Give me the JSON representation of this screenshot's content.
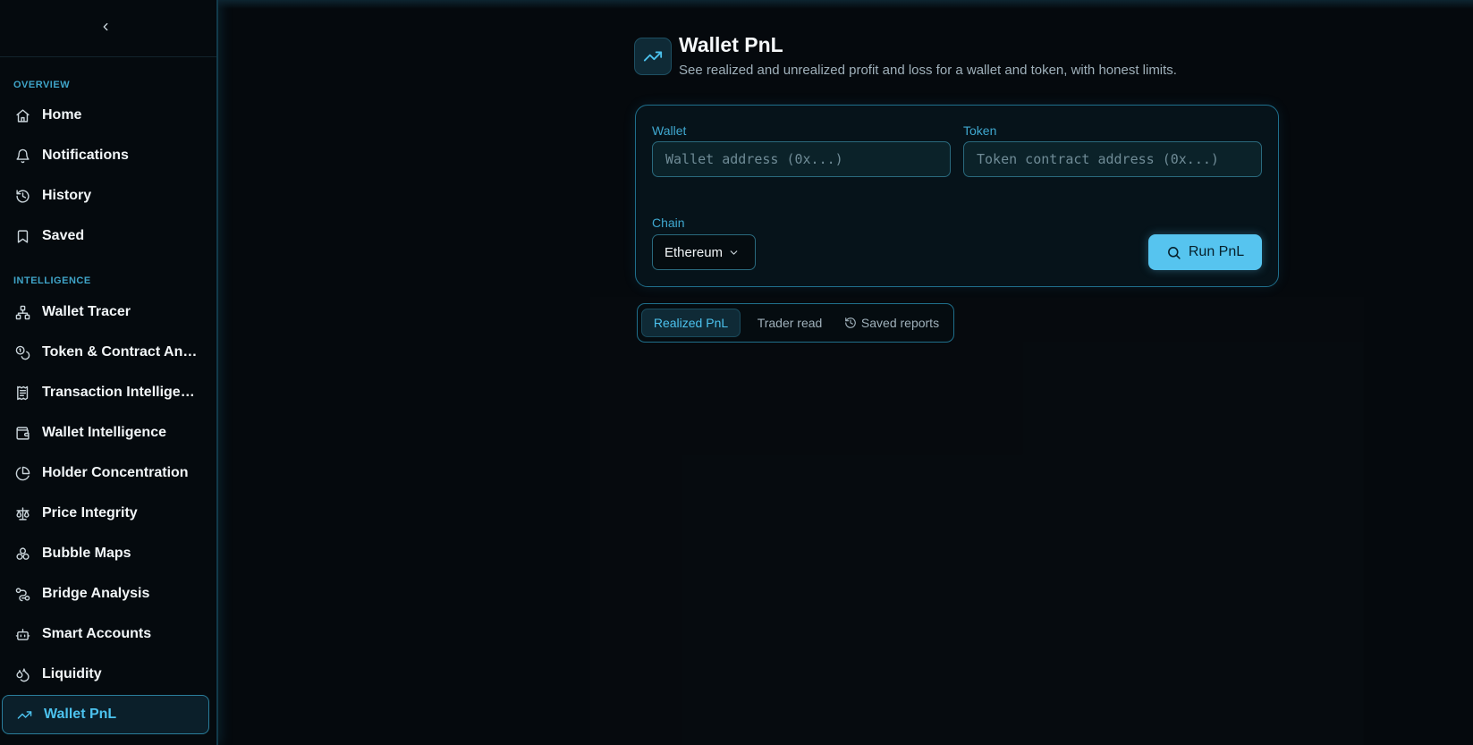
{
  "sidebar": {
    "collapse_icon": "chevron-left-icon",
    "sections": [
      {
        "label": "OVERVIEW"
      },
      {
        "label": "INTELLIGENCE"
      }
    ],
    "items": [
      {
        "label": "Home",
        "icon": "home-icon"
      },
      {
        "label": "Notifications",
        "icon": "bell-icon"
      },
      {
        "label": "History",
        "icon": "history-icon"
      },
      {
        "label": "Saved",
        "icon": "bookmark-icon"
      },
      {
        "label": "Wallet Tracer",
        "icon": "network-icon"
      },
      {
        "label": "Token & Contract Anal…",
        "icon": "coins-icon"
      },
      {
        "label": "Transaction Intelligen…",
        "icon": "receipt-icon"
      },
      {
        "label": "Wallet Intelligence",
        "icon": "wallet-icon"
      },
      {
        "label": "Holder Concentration",
        "icon": "pie-chart-icon"
      },
      {
        "label": "Price Integrity",
        "icon": "scale-icon"
      },
      {
        "label": "Bubble Maps",
        "icon": "bubbles-icon"
      },
      {
        "label": "Bridge Analysis",
        "icon": "bridge-icon"
      },
      {
        "label": "Smart Accounts",
        "icon": "bot-icon"
      },
      {
        "label": "Liquidity",
        "icon": "droplets-icon"
      },
      {
        "label": "Wallet PnL",
        "icon": "trending-up-icon",
        "active": true
      }
    ]
  },
  "header": {
    "icon": "trending-up-icon",
    "title": "Wallet PnL",
    "subtitle": "See realized and unrealized profit and loss for a wallet and token, with honest limits."
  },
  "form": {
    "wallet_label": "Wallet",
    "wallet_placeholder": "Wallet address (0x...)",
    "wallet_value": "",
    "token_label": "Token",
    "token_placeholder": "Token contract address (0x...)",
    "token_value": "",
    "chain_label": "Chain",
    "chain_selected": "Ethereum",
    "run_label": "Run PnL"
  },
  "tabs": [
    {
      "label": "Realized PnL",
      "active": true
    },
    {
      "label": "Trader read"
    },
    {
      "label": "Saved reports",
      "icon": "history-icon"
    }
  ],
  "colors": {
    "accent": "#4cc2ee",
    "button": "#56c4ef",
    "background": "#05090d",
    "border": "#1f6f8c"
  }
}
